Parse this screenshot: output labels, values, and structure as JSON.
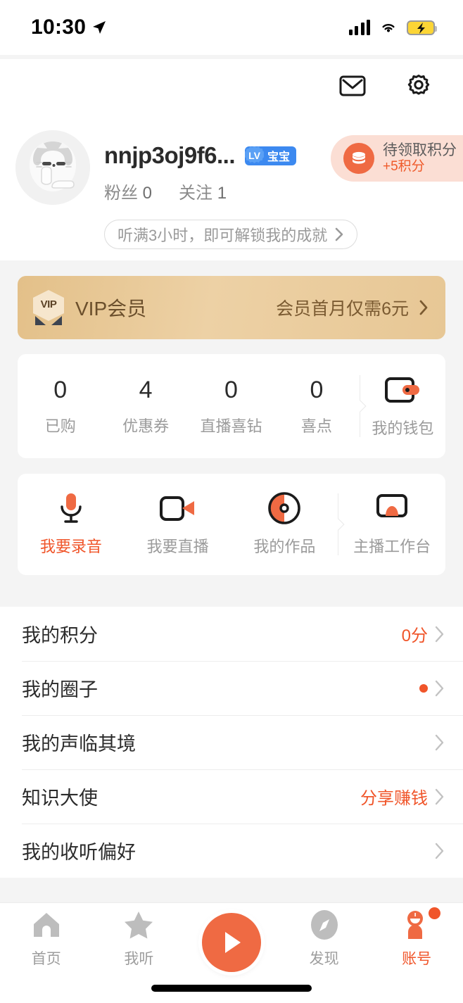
{
  "status_bar": {
    "time": "10:30",
    "location_icon": "location-arrow-icon",
    "signal_icon": "cellular-signal-icon",
    "wifi_icon": "wifi-icon",
    "battery_icon": "battery-charging-icon"
  },
  "header": {
    "mail_icon": "mail-icon",
    "settings_icon": "gear-icon"
  },
  "profile": {
    "avatar_icon": "user-avatar-cat",
    "username": "nnjp3oj9f6...",
    "level_badge": {
      "lv": "LV",
      "label": "宝宝"
    },
    "followers_label": "粉丝",
    "followers_count": "0",
    "following_label": "关注",
    "following_count": "1",
    "achievement_text": "听满3小时，即可解锁我的成就",
    "achievement_chevron": "chevron-right-icon",
    "points_pill": {
      "icon": "coin-stack-icon",
      "title": "待领取积分",
      "subtitle": "+5积分"
    }
  },
  "vip_banner": {
    "badge_text": "VIP",
    "title": "VIP会员",
    "cta": "会员首月仅需6元",
    "chevron": "chevron-right-icon"
  },
  "stats_card": {
    "items": [
      {
        "value": "0",
        "label": "已购"
      },
      {
        "value": "4",
        "label": "优惠券"
      },
      {
        "value": "0",
        "label": "直播喜钻"
      },
      {
        "value": "0",
        "label": "喜点"
      }
    ],
    "wallet": {
      "icon": "wallet-icon",
      "label": "我的钱包"
    }
  },
  "actions_card": {
    "items": [
      {
        "icon": "microphone-icon",
        "label": "我要录音",
        "highlight": true
      },
      {
        "icon": "video-camera-icon",
        "label": "我要直播",
        "highlight": false
      },
      {
        "icon": "disc-icon",
        "label": "我的作品",
        "highlight": false
      }
    ],
    "studio": {
      "icon": "monitor-icon",
      "label": "主播工作台"
    }
  },
  "menu": {
    "rows": [
      {
        "title": "我的积分",
        "value": "0分",
        "dot": false
      },
      {
        "title": "我的圈子",
        "value": "",
        "dot": true
      },
      {
        "title": "我的声临其境",
        "value": "",
        "dot": false
      },
      {
        "title": "知识大使",
        "value": "分享赚钱",
        "dot": false
      },
      {
        "title": "我的收听偏好",
        "value": "",
        "dot": false
      }
    ]
  },
  "tab_bar": {
    "tabs": [
      {
        "icon": "home-icon",
        "label": "首页",
        "active": false
      },
      {
        "icon": "star-icon",
        "label": "我听",
        "active": false
      },
      {
        "icon": "compass-icon",
        "label": "发现",
        "active": false
      },
      {
        "icon": "account-icon",
        "label": "账号",
        "active": true
      }
    ],
    "play_button_icon": "play-icon"
  },
  "colors": {
    "accent": "#f0552a",
    "play_button": "#ef6a43",
    "vip_gold": "#e7c795",
    "points_pill_bg": "#fbded4",
    "level_badge_blue": "#3c89f0"
  }
}
